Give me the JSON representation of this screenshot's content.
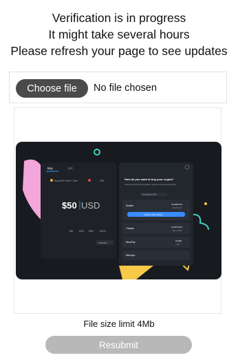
{
  "header": {
    "line1": "Verification is in progress",
    "line2": "It might take several hours",
    "line3": "Please refresh your page to see updates"
  },
  "upload": {
    "button_label": "Choose file",
    "status": "No file chosen"
  },
  "preview": {
    "tabs": [
      "Buy",
      "Sell"
    ],
    "account_label": "Account ID: 0xa7b...3ba4",
    "currency": "USD",
    "amount": "$50",
    "amount_currency": "USD",
    "quick_amounts": [
      "$50",
      "$100",
      "$500",
      "$1000"
    ],
    "rate_label": "0.55 ETH",
    "panel_title": "How do you want to buy your crypto?",
    "panel_subtitle": "Compare rates from these providers. Quotes are sorted by overall price.",
    "panel_note": "New quotes in 0:29",
    "providers": [
      {
        "name": "Sardine",
        "amount": "0.0468 ETH",
        "fiat": "≈ $49.85 USD",
        "cta": "Continue with Sardine"
      },
      {
        "name": "Transak",
        "amount": "0.0467 ETH",
        "fiat": "≈ $49.73 USD"
      },
      {
        "name": "MoonPay",
        "amount": "0.0463",
        "fiat": "≈ $49"
      },
      {
        "name": "Mercuryo",
        "amount": "",
        "fiat": ""
      }
    ],
    "colors": {
      "card_bg": "#171a1f",
      "panel_bg": "#22262d",
      "accent_blue": "#3a8dff",
      "pink": "#f2a6d9",
      "yellow": "#f7c948",
      "teal": "#3fd1c2",
      "light_blue": "#8fc4f5"
    }
  },
  "footer": {
    "limit_text": "File size limit 4Mb",
    "resubmit_label": "Resubmit"
  }
}
